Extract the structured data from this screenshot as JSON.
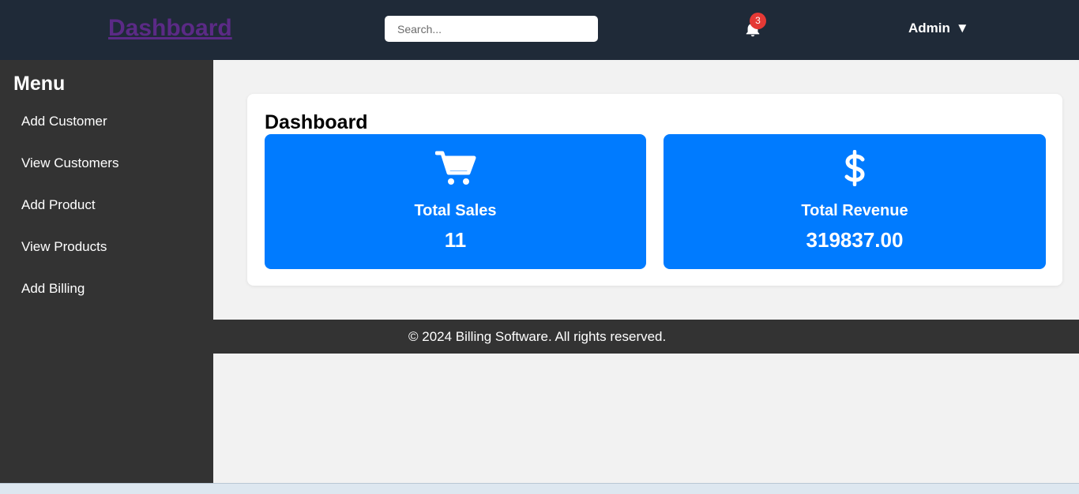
{
  "header": {
    "brand": "Dashboard",
    "search_placeholder": "Search...",
    "notifications_count": "3",
    "user_label": "Admin",
    "user_caret": "▼"
  },
  "sidebar": {
    "title": "Menu",
    "items": [
      {
        "label": "Add Customer"
      },
      {
        "label": "View Customers"
      },
      {
        "label": "Add Product"
      },
      {
        "label": "View Products"
      },
      {
        "label": "Add Billing"
      }
    ]
  },
  "main": {
    "title": "Dashboard",
    "cards": [
      {
        "icon": "shopping-cart-icon",
        "label": "Total Sales",
        "value": "11"
      },
      {
        "icon": "dollar-sign-icon",
        "label": "Total Revenue",
        "value": "319837.00"
      }
    ]
  },
  "footer": {
    "text": "© 2024 Billing Software. All rights reserved."
  },
  "colors": {
    "header_bg": "#1f2a38",
    "sidebar_bg": "#333333",
    "card_accent": "#007bff",
    "brand_link": "#5b2a86",
    "badge": "#e53935",
    "page_bg": "#f2f2f2"
  }
}
